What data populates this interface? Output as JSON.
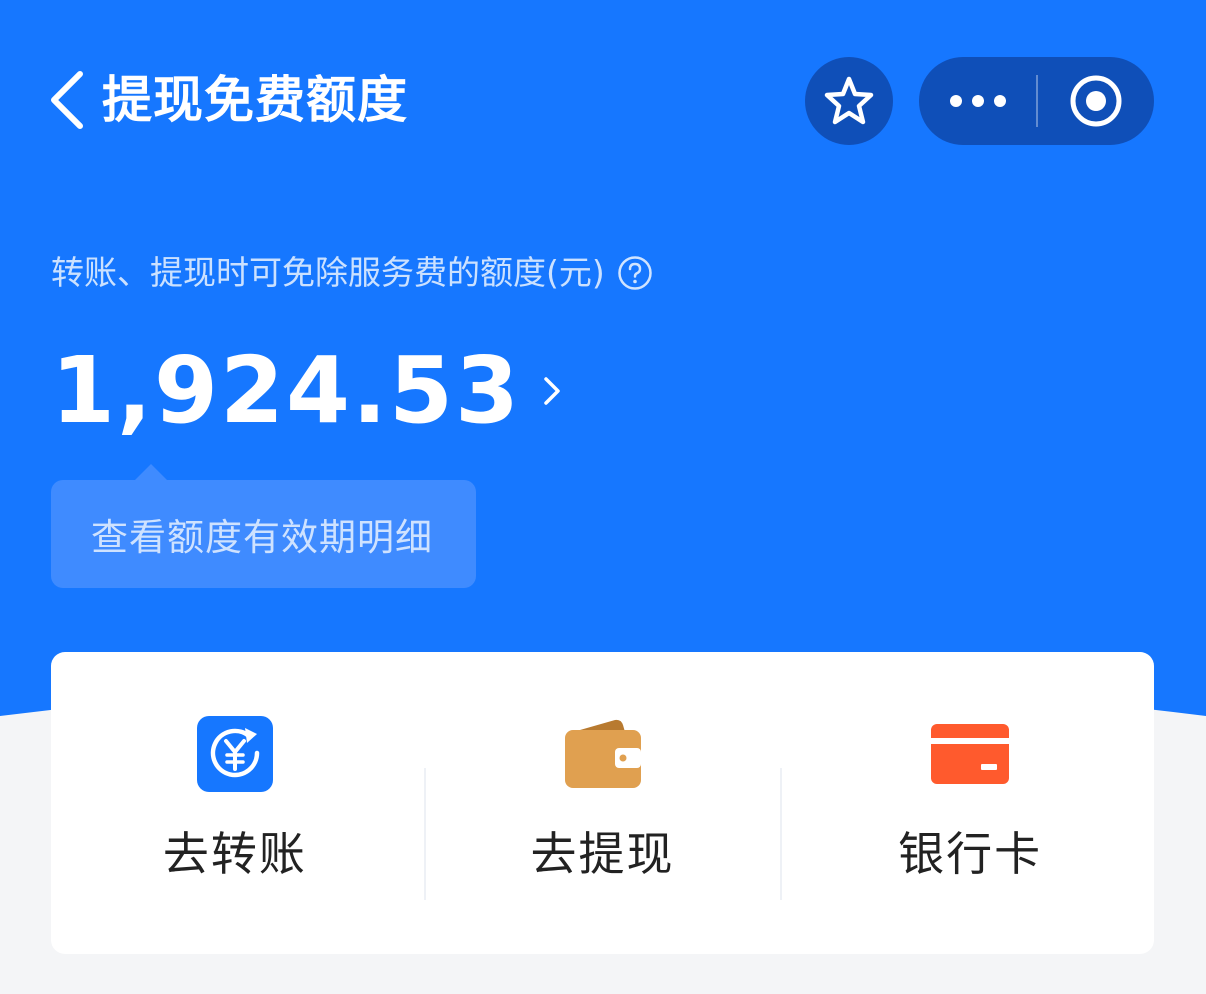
{
  "nav": {
    "title": "提现免费额度",
    "back_icon": "chevron-left-icon",
    "favorite_icon": "star-icon",
    "more_icon": "more-dots-icon",
    "close_icon": "target-circle-icon"
  },
  "quota": {
    "subtitle": "转账、提现时可免除服务费的额度(元)",
    "help_icon": "question-circle-icon",
    "amount": "1,924.53",
    "detail_link": "查看额度有效期明细"
  },
  "actions": [
    {
      "label": "去转账",
      "icon": "yuan-transfer-icon",
      "color": "#1677ff"
    },
    {
      "label": "去提现",
      "icon": "wallet-icon",
      "color": "#e0a050"
    },
    {
      "label": "银行卡",
      "icon": "bank-card-icon",
      "color": "#ff5a2d"
    }
  ],
  "colors": {
    "primary_blue": "#1677ff",
    "capsule_blue": "#0f4fb8",
    "white": "#ffffff"
  }
}
